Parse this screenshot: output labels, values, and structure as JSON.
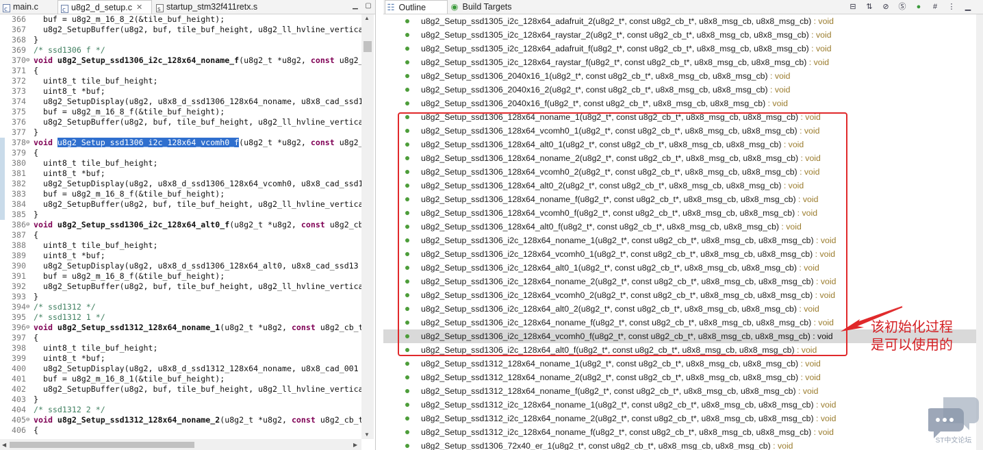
{
  "editor": {
    "tabs": [
      {
        "label": "main.c"
      },
      {
        "label": "u8g2_d_setup.c"
      },
      {
        "label": "startup_stm32f411retx.s"
      }
    ],
    "lines": [
      {
        "n": "366",
        "fold": "",
        "code": "  buf = u8g2_m_16_8_2(&tile_buf_height);"
      },
      {
        "n": "367",
        "fold": "",
        "code": "  u8g2_SetupBuffer(u8g2, buf, tile_buf_height, u8g2_ll_hvline_vertica"
      },
      {
        "n": "368",
        "fold": "",
        "code": "}"
      },
      {
        "n": "369",
        "fold": "",
        "code": "/* ssd1306 f */"
      },
      {
        "n": "370",
        "fold": "⊖",
        "code": "void u8g2_Setup_ssd1306_i2c_128x64_noname_f(u8g2_t *u8g2, const u8g2_"
      },
      {
        "n": "371",
        "fold": "",
        "code": "{"
      },
      {
        "n": "372",
        "fold": "",
        "code": "  uint8_t tile_buf_height;"
      },
      {
        "n": "373",
        "fold": "",
        "code": "  uint8_t *buf;"
      },
      {
        "n": "374",
        "fold": "",
        "code": "  u8g2_SetupDisplay(u8g2, u8x8_d_ssd1306_128x64_noname, u8x8_cad_ssd1"
      },
      {
        "n": "375",
        "fold": "",
        "code": "  buf = u8g2_m_16_8_f(&tile_buf_height);"
      },
      {
        "n": "376",
        "fold": "",
        "code": "  u8g2_SetupBuffer(u8g2, buf, tile_buf_height, u8g2_ll_hvline_vertica"
      },
      {
        "n": "377",
        "fold": "",
        "code": "}"
      },
      {
        "n": "378",
        "fold": "⊖",
        "code": "void u8g2_Setup_ssd1306_i2c_128x64_vcomh0_f(u8g2_t *u8g2, const u8g2_"
      },
      {
        "n": "379",
        "fold": "",
        "code": "{"
      },
      {
        "n": "380",
        "fold": "",
        "code": "  uint8_t tile_buf_height;"
      },
      {
        "n": "381",
        "fold": "",
        "code": "  uint8_t *buf;"
      },
      {
        "n": "382",
        "fold": "",
        "code": "  u8g2_SetupDisplay(u8g2, u8x8_d_ssd1306_128x64_vcomh0, u8x8_cad_ssd1"
      },
      {
        "n": "383",
        "fold": "",
        "code": "  buf = u8g2_m_16_8_f(&tile_buf_height);"
      },
      {
        "n": "384",
        "fold": "",
        "code": "  u8g2_SetupBuffer(u8g2, buf, tile_buf_height, u8g2_ll_hvline_vertica"
      },
      {
        "n": "385",
        "fold": "",
        "code": "}"
      },
      {
        "n": "386",
        "fold": "⊖",
        "code": "void u8g2_Setup_ssd1306_i2c_128x64_alt0_f(u8g2_t *u8g2, const u8g2_cb"
      },
      {
        "n": "387",
        "fold": "",
        "code": "{"
      },
      {
        "n": "388",
        "fold": "",
        "code": "  uint8_t tile_buf_height;"
      },
      {
        "n": "389",
        "fold": "",
        "code": "  uint8_t *buf;"
      },
      {
        "n": "390",
        "fold": "",
        "code": "  u8g2_SetupDisplay(u8g2, u8x8_d_ssd1306_128x64_alt0, u8x8_cad_ssd13"
      },
      {
        "n": "391",
        "fold": "",
        "code": "  buf = u8g2_m_16_8_f(&tile_buf_height);"
      },
      {
        "n": "392",
        "fold": "",
        "code": "  u8g2_SetupBuffer(u8g2, buf, tile_buf_height, u8g2_ll_hvline_vertica"
      },
      {
        "n": "393",
        "fold": "",
        "code": "}"
      },
      {
        "n": "394",
        "fold": "⊖",
        "code": "/* ssd1312 */"
      },
      {
        "n": "395",
        "fold": "",
        "code": "/* ssd1312 1 */"
      },
      {
        "n": "396",
        "fold": "⊖",
        "code": "void u8g2_Setup_ssd1312_128x64_noname_1(u8g2_t *u8g2, const u8g2_cb_t"
      },
      {
        "n": "397",
        "fold": "",
        "code": "{"
      },
      {
        "n": "398",
        "fold": "",
        "code": "  uint8_t tile_buf_height;"
      },
      {
        "n": "399",
        "fold": "",
        "code": "  uint8_t *buf;"
      },
      {
        "n": "400",
        "fold": "",
        "code": "  u8g2_SetupDisplay(u8g2, u8x8_d_ssd1312_128x64_noname, u8x8_cad_001"
      },
      {
        "n": "401",
        "fold": "",
        "code": "  buf = u8g2_m_16_8_1(&tile_buf_height);"
      },
      {
        "n": "402",
        "fold": "",
        "code": "  u8g2_SetupBuffer(u8g2, buf, tile_buf_height, u8g2_ll_hvline_vertica"
      },
      {
        "n": "403",
        "fold": "",
        "code": "}"
      },
      {
        "n": "404",
        "fold": "",
        "code": "/* ssd1312 2 */"
      },
      {
        "n": "405",
        "fold": "⊖",
        "code": "void u8g2_Setup_ssd1312_128x64_noname_2(u8g2_t *u8g2, const u8g2_cb_t"
      },
      {
        "n": "406",
        "fold": "",
        "code": "{"
      }
    ],
    "selected_text": "u8g2_Setup_ssd1306_i2c_128x64_vcomh0_f"
  },
  "outline": {
    "tabs": [
      {
        "label": "Outline",
        "icon": "outline-icon"
      },
      {
        "label": "Build Targets",
        "icon": "build-targets-icon"
      }
    ],
    "toolbar_icons": [
      "collapse-all-icon",
      "sort-icon",
      "hide-fields-icon",
      "hide-static-icon",
      "hide-non-public-icon",
      "focus-icon",
      "settings-icon",
      "menu-icon"
    ],
    "items": [
      {
        "name": "u8g2_Setup_ssd1305_i2c_128x64_adafruit_2(u8g2_t*, const u8g2_cb_t*, u8x8_msg_cb, u8x8_msg_cb)",
        "ret": " : void"
      },
      {
        "name": "u8g2_Setup_ssd1305_i2c_128x64_raystar_2(u8g2_t*, const u8g2_cb_t*, u8x8_msg_cb, u8x8_msg_cb)",
        "ret": " : void"
      },
      {
        "name": "u8g2_Setup_ssd1305_i2c_128x64_adafruit_f(u8g2_t*, const u8g2_cb_t*, u8x8_msg_cb, u8x8_msg_cb)",
        "ret": " : void"
      },
      {
        "name": "u8g2_Setup_ssd1305_i2c_128x64_raystar_f(u8g2_t*, const u8g2_cb_t*, u8x8_msg_cb, u8x8_msg_cb)",
        "ret": " : void"
      },
      {
        "name": "u8g2_Setup_ssd1306_2040x16_1(u8g2_t*, const u8g2_cb_t*, u8x8_msg_cb, u8x8_msg_cb)",
        "ret": " : void"
      },
      {
        "name": "u8g2_Setup_ssd1306_2040x16_2(u8g2_t*, const u8g2_cb_t*, u8x8_msg_cb, u8x8_msg_cb)",
        "ret": " : void"
      },
      {
        "name": "u8g2_Setup_ssd1306_2040x16_f(u8g2_t*, const u8g2_cb_t*, u8x8_msg_cb, u8x8_msg_cb)",
        "ret": " : void"
      },
      {
        "name": "u8g2_Setup_ssd1306_128x64_noname_1(u8g2_t*, const u8g2_cb_t*, u8x8_msg_cb, u8x8_msg_cb)",
        "ret": " : void"
      },
      {
        "name": "u8g2_Setup_ssd1306_128x64_vcomh0_1(u8g2_t*, const u8g2_cb_t*, u8x8_msg_cb, u8x8_msg_cb)",
        "ret": " : void"
      },
      {
        "name": "u8g2_Setup_ssd1306_128x64_alt0_1(u8g2_t*, const u8g2_cb_t*, u8x8_msg_cb, u8x8_msg_cb)",
        "ret": " : void"
      },
      {
        "name": "u8g2_Setup_ssd1306_128x64_noname_2(u8g2_t*, const u8g2_cb_t*, u8x8_msg_cb, u8x8_msg_cb)",
        "ret": " : void"
      },
      {
        "name": "u8g2_Setup_ssd1306_128x64_vcomh0_2(u8g2_t*, const u8g2_cb_t*, u8x8_msg_cb, u8x8_msg_cb)",
        "ret": " : void"
      },
      {
        "name": "u8g2_Setup_ssd1306_128x64_alt0_2(u8g2_t*, const u8g2_cb_t*, u8x8_msg_cb, u8x8_msg_cb)",
        "ret": " : void"
      },
      {
        "name": "u8g2_Setup_ssd1306_128x64_noname_f(u8g2_t*, const u8g2_cb_t*, u8x8_msg_cb, u8x8_msg_cb)",
        "ret": " : void"
      },
      {
        "name": "u8g2_Setup_ssd1306_128x64_vcomh0_f(u8g2_t*, const u8g2_cb_t*, u8x8_msg_cb, u8x8_msg_cb)",
        "ret": " : void"
      },
      {
        "name": "u8g2_Setup_ssd1306_128x64_alt0_f(u8g2_t*, const u8g2_cb_t*, u8x8_msg_cb, u8x8_msg_cb)",
        "ret": " : void"
      },
      {
        "name": "u8g2_Setup_ssd1306_i2c_128x64_noname_1(u8g2_t*, const u8g2_cb_t*, u8x8_msg_cb, u8x8_msg_cb)",
        "ret": " : void"
      },
      {
        "name": "u8g2_Setup_ssd1306_i2c_128x64_vcomh0_1(u8g2_t*, const u8g2_cb_t*, u8x8_msg_cb, u8x8_msg_cb)",
        "ret": " : void"
      },
      {
        "name": "u8g2_Setup_ssd1306_i2c_128x64_alt0_1(u8g2_t*, const u8g2_cb_t*, u8x8_msg_cb, u8x8_msg_cb)",
        "ret": " : void"
      },
      {
        "name": "u8g2_Setup_ssd1306_i2c_128x64_noname_2(u8g2_t*, const u8g2_cb_t*, u8x8_msg_cb, u8x8_msg_cb)",
        "ret": " : void"
      },
      {
        "name": "u8g2_Setup_ssd1306_i2c_128x64_vcomh0_2(u8g2_t*, const u8g2_cb_t*, u8x8_msg_cb, u8x8_msg_cb)",
        "ret": " : void"
      },
      {
        "name": "u8g2_Setup_ssd1306_i2c_128x64_alt0_2(u8g2_t*, const u8g2_cb_t*, u8x8_msg_cb, u8x8_msg_cb)",
        "ret": " : void"
      },
      {
        "name": "u8g2_Setup_ssd1306_i2c_128x64_noname_f(u8g2_t*, const u8g2_cb_t*, u8x8_msg_cb, u8x8_msg_cb)",
        "ret": " : void"
      },
      {
        "name": "u8g2_Setup_ssd1306_i2c_128x64_vcomh0_f(u8g2_t*, const u8g2_cb_t*, u8x8_msg_cb, u8x8_msg_cb)",
        "ret": " : void",
        "highlighted": true
      },
      {
        "name": "u8g2_Setup_ssd1306_i2c_128x64_alt0_f(u8g2_t*, const u8g2_cb_t*, u8x8_msg_cb, u8x8_msg_cb)",
        "ret": " : void"
      },
      {
        "name": "u8g2_Setup_ssd1312_128x64_noname_1(u8g2_t*, const u8g2_cb_t*, u8x8_msg_cb, u8x8_msg_cb)",
        "ret": " : void"
      },
      {
        "name": "u8g2_Setup_ssd1312_128x64_noname_2(u8g2_t*, const u8g2_cb_t*, u8x8_msg_cb, u8x8_msg_cb)",
        "ret": " : void"
      },
      {
        "name": "u8g2_Setup_ssd1312_128x64_noname_f(u8g2_t*, const u8g2_cb_t*, u8x8_msg_cb, u8x8_msg_cb)",
        "ret": " : void"
      },
      {
        "name": "u8g2_Setup_ssd1312_i2c_128x64_noname_1(u8g2_t*, const u8g2_cb_t*, u8x8_msg_cb, u8x8_msg_cb)",
        "ret": " : void"
      },
      {
        "name": "u8g2_Setup_ssd1312_i2c_128x64_noname_2(u8g2_t*, const u8g2_cb_t*, u8x8_msg_cb, u8x8_msg_cb)",
        "ret": " : void"
      },
      {
        "name": "u8g2_Setup_ssd1312_i2c_128x64_noname_f(u8g2_t*, const u8g2_cb_t*, u8x8_msg_cb, u8x8_msg_cb)",
        "ret": " : void"
      },
      {
        "name": "u8g2_Setup_ssd1306_72x40_er_1(u8g2_t*, const u8g2_cb_t*, u8x8_msg_cb, u8x8_msg_cb)",
        "ret": " : void"
      }
    ]
  },
  "annotation": {
    "line1": "该初始化过程",
    "line2": "是可以使用的",
    "color": "#d41f23"
  },
  "watermark": {
    "text": "ST中文论坛"
  },
  "colors": {
    "selection": "#2f6fce",
    "keyword": "#7f0055",
    "comment": "#3f7f5f",
    "method_dot": "#4d9d3a",
    "return_type": "#9b7d2f"
  }
}
